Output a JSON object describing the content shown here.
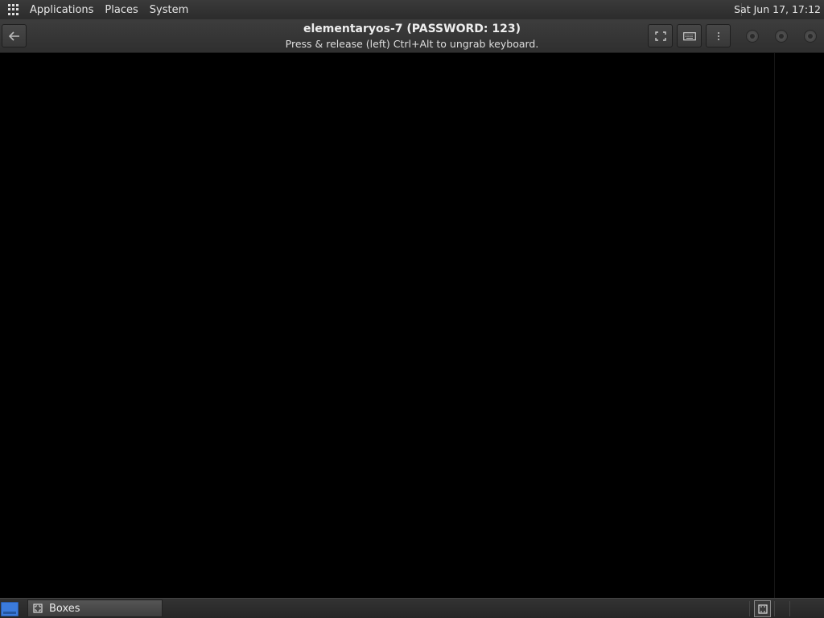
{
  "top_panel": {
    "menus": [
      "Applications",
      "Places",
      "System"
    ],
    "clock": "Sat Jun 17, 17:12"
  },
  "header": {
    "title": "elementaryos-7 (PASSWORD: 123)",
    "subtitle": "Press & release (left) Ctrl+Alt to ungrab keyboard."
  },
  "icons": {
    "apps": "apps-grid-icon",
    "back": "arrow-left-icon",
    "fullscreen": "fullscreen-icon",
    "keyboard": "keyboard-icon",
    "menu": "vertical-dots-icon",
    "minimize": "minimize-icon",
    "maximize": "maximize-icon",
    "close": "close-icon"
  },
  "taskbar": {
    "items": [
      {
        "label": "Boxes"
      }
    ]
  },
  "colors": {
    "show_desktop": "#3b7bdc",
    "panel": "#2c2c2c"
  }
}
